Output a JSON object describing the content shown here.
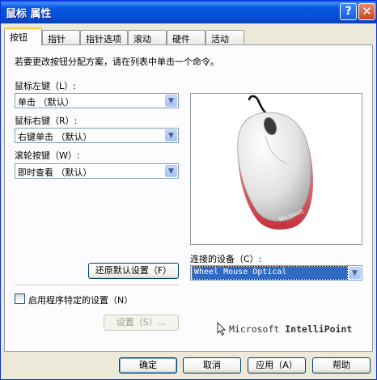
{
  "window": {
    "title": "鼠标 属性",
    "help": "?",
    "close": "✕"
  },
  "tabs": [
    {
      "label": "按钮"
    },
    {
      "label": "指针"
    },
    {
      "label": "指针选项"
    },
    {
      "label": "滚动"
    },
    {
      "label": "硬件"
    },
    {
      "label": "活动"
    }
  ],
  "panel": {
    "instruction": "若要更改按钮分配方案，请在列表中单击一个命令。",
    "left_button": {
      "label": "鼠标左键（L）:",
      "value": "单击 （默认）"
    },
    "right_button": {
      "label": "鼠标右键（R）:",
      "value": "右键单击 （默认）"
    },
    "wheel_button": {
      "label": "滚轮按键（W）:",
      "value": "即时查看 （默认）"
    },
    "restore_defaults": "还原默认设置（F）",
    "connected_device": {
      "label": "连接的设备（C）:",
      "value": "Wheel Mouse Optical"
    },
    "app_specific_checkbox": {
      "label": "启用程序特定的设置（N）",
      "checked": false
    },
    "settings_button": "设置（S）...",
    "brand": {
      "prefix": "Microsoft",
      "name": "IntelliPoint"
    },
    "mouse_logo": "Microsoft"
  },
  "footer": {
    "ok": "确定",
    "cancel": "取消",
    "apply": "应用（A）",
    "help": "帮助"
  },
  "colors": {
    "titlebar": "#0a5be5",
    "selection": "#316ac5",
    "face": "#ece9d8"
  }
}
